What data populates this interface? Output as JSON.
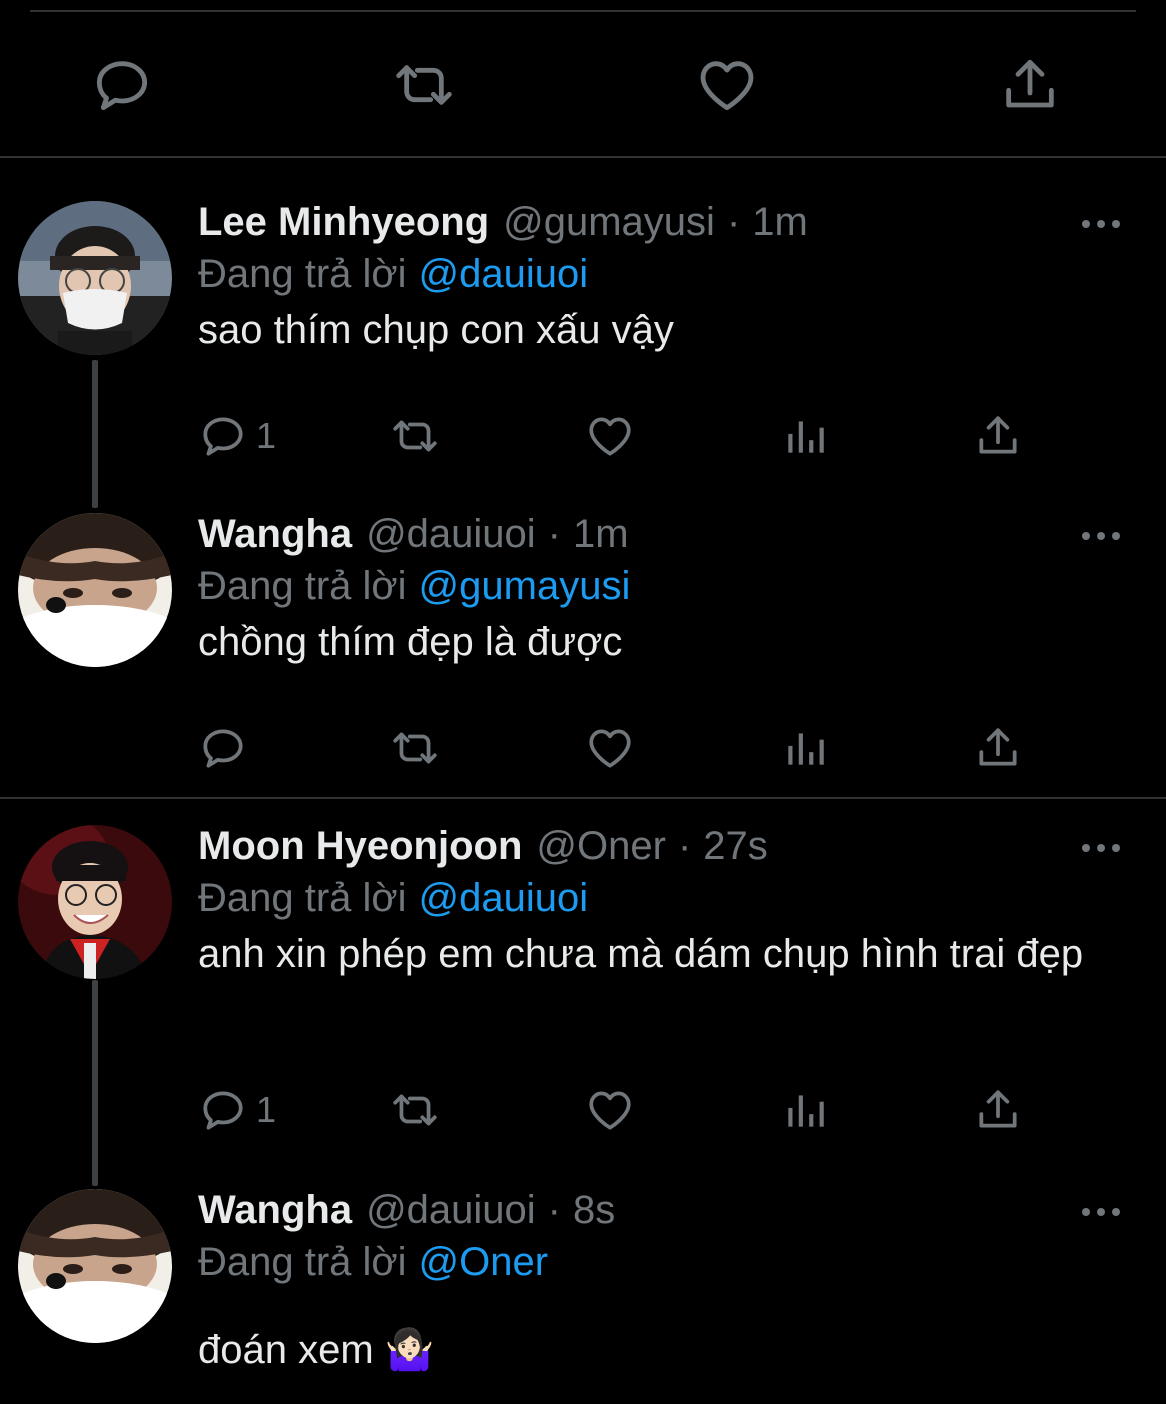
{
  "colors": {
    "background": "#000000",
    "text": "#e7e9ea",
    "secondary": "#71767b",
    "mention": "#1d9bf0",
    "divider": "#2f3336"
  },
  "main_actions": [
    "reply-icon",
    "retweet-icon",
    "like-icon",
    "share-icon"
  ],
  "reply_prefix": "Đang trả lời",
  "tweets": [
    {
      "name": "Lee Minhyeong",
      "handle": "@gumayusi",
      "time": "1m",
      "reply_to": "@dauiuoi",
      "text": "sao thím chụp con xấu vậy",
      "reply_count": "1"
    },
    {
      "name": "Wangha",
      "handle": "@dauiuoi",
      "time": "1m",
      "reply_to": "@gumayusi",
      "text": "chồng thím đẹp là được",
      "reply_count": ""
    },
    {
      "name": "Moon Hyeonjoon",
      "handle": "@Oner",
      "time": "27s",
      "reply_to": "@dauiuoi",
      "text": "anh xin phép em chưa mà dám chụp hình trai đẹp",
      "reply_count": "1"
    },
    {
      "name": "Wangha",
      "handle": "@dauiuoi",
      "time": "8s",
      "reply_to": "@Oner",
      "text": "đoán xem 🤷🏻‍♀️",
      "reply_count": ""
    }
  ],
  "separator": "·"
}
